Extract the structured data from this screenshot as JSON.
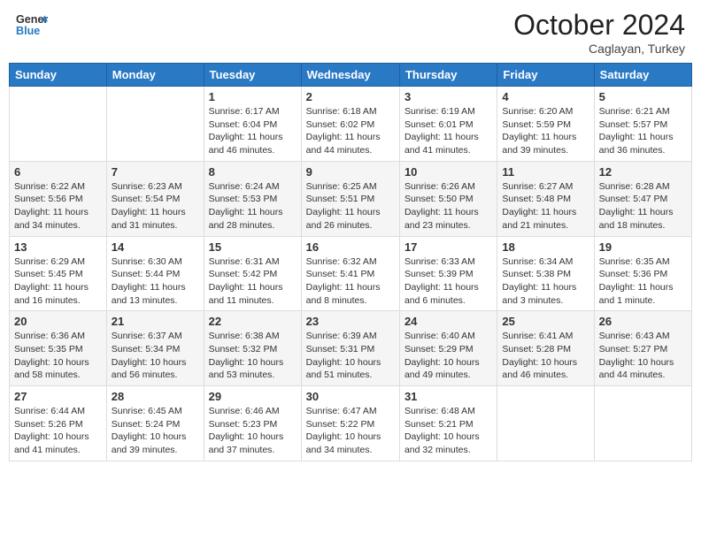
{
  "header": {
    "logo_line1": "General",
    "logo_line2": "Blue",
    "month": "October 2024",
    "location": "Caglayan, Turkey"
  },
  "weekdays": [
    "Sunday",
    "Monday",
    "Tuesday",
    "Wednesday",
    "Thursday",
    "Friday",
    "Saturday"
  ],
  "weeks": [
    [
      {
        "day": "",
        "detail": ""
      },
      {
        "day": "",
        "detail": ""
      },
      {
        "day": "1",
        "detail": "Sunrise: 6:17 AM\nSunset: 6:04 PM\nDaylight: 11 hours and 46 minutes."
      },
      {
        "day": "2",
        "detail": "Sunrise: 6:18 AM\nSunset: 6:02 PM\nDaylight: 11 hours and 44 minutes."
      },
      {
        "day": "3",
        "detail": "Sunrise: 6:19 AM\nSunset: 6:01 PM\nDaylight: 11 hours and 41 minutes."
      },
      {
        "day": "4",
        "detail": "Sunrise: 6:20 AM\nSunset: 5:59 PM\nDaylight: 11 hours and 39 minutes."
      },
      {
        "day": "5",
        "detail": "Sunrise: 6:21 AM\nSunset: 5:57 PM\nDaylight: 11 hours and 36 minutes."
      }
    ],
    [
      {
        "day": "6",
        "detail": "Sunrise: 6:22 AM\nSunset: 5:56 PM\nDaylight: 11 hours and 34 minutes."
      },
      {
        "day": "7",
        "detail": "Sunrise: 6:23 AM\nSunset: 5:54 PM\nDaylight: 11 hours and 31 minutes."
      },
      {
        "day": "8",
        "detail": "Sunrise: 6:24 AM\nSunset: 5:53 PM\nDaylight: 11 hours and 28 minutes."
      },
      {
        "day": "9",
        "detail": "Sunrise: 6:25 AM\nSunset: 5:51 PM\nDaylight: 11 hours and 26 minutes."
      },
      {
        "day": "10",
        "detail": "Sunrise: 6:26 AM\nSunset: 5:50 PM\nDaylight: 11 hours and 23 minutes."
      },
      {
        "day": "11",
        "detail": "Sunrise: 6:27 AM\nSunset: 5:48 PM\nDaylight: 11 hours and 21 minutes."
      },
      {
        "day": "12",
        "detail": "Sunrise: 6:28 AM\nSunset: 5:47 PM\nDaylight: 11 hours and 18 minutes."
      }
    ],
    [
      {
        "day": "13",
        "detail": "Sunrise: 6:29 AM\nSunset: 5:45 PM\nDaylight: 11 hours and 16 minutes."
      },
      {
        "day": "14",
        "detail": "Sunrise: 6:30 AM\nSunset: 5:44 PM\nDaylight: 11 hours and 13 minutes."
      },
      {
        "day": "15",
        "detail": "Sunrise: 6:31 AM\nSunset: 5:42 PM\nDaylight: 11 hours and 11 minutes."
      },
      {
        "day": "16",
        "detail": "Sunrise: 6:32 AM\nSunset: 5:41 PM\nDaylight: 11 hours and 8 minutes."
      },
      {
        "day": "17",
        "detail": "Sunrise: 6:33 AM\nSunset: 5:39 PM\nDaylight: 11 hours and 6 minutes."
      },
      {
        "day": "18",
        "detail": "Sunrise: 6:34 AM\nSunset: 5:38 PM\nDaylight: 11 hours and 3 minutes."
      },
      {
        "day": "19",
        "detail": "Sunrise: 6:35 AM\nSunset: 5:36 PM\nDaylight: 11 hours and 1 minute."
      }
    ],
    [
      {
        "day": "20",
        "detail": "Sunrise: 6:36 AM\nSunset: 5:35 PM\nDaylight: 10 hours and 58 minutes."
      },
      {
        "day": "21",
        "detail": "Sunrise: 6:37 AM\nSunset: 5:34 PM\nDaylight: 10 hours and 56 minutes."
      },
      {
        "day": "22",
        "detail": "Sunrise: 6:38 AM\nSunset: 5:32 PM\nDaylight: 10 hours and 53 minutes."
      },
      {
        "day": "23",
        "detail": "Sunrise: 6:39 AM\nSunset: 5:31 PM\nDaylight: 10 hours and 51 minutes."
      },
      {
        "day": "24",
        "detail": "Sunrise: 6:40 AM\nSunset: 5:29 PM\nDaylight: 10 hours and 49 minutes."
      },
      {
        "day": "25",
        "detail": "Sunrise: 6:41 AM\nSunset: 5:28 PM\nDaylight: 10 hours and 46 minutes."
      },
      {
        "day": "26",
        "detail": "Sunrise: 6:43 AM\nSunset: 5:27 PM\nDaylight: 10 hours and 44 minutes."
      }
    ],
    [
      {
        "day": "27",
        "detail": "Sunrise: 6:44 AM\nSunset: 5:26 PM\nDaylight: 10 hours and 41 minutes."
      },
      {
        "day": "28",
        "detail": "Sunrise: 6:45 AM\nSunset: 5:24 PM\nDaylight: 10 hours and 39 minutes."
      },
      {
        "day": "29",
        "detail": "Sunrise: 6:46 AM\nSunset: 5:23 PM\nDaylight: 10 hours and 37 minutes."
      },
      {
        "day": "30",
        "detail": "Sunrise: 6:47 AM\nSunset: 5:22 PM\nDaylight: 10 hours and 34 minutes."
      },
      {
        "day": "31",
        "detail": "Sunrise: 6:48 AM\nSunset: 5:21 PM\nDaylight: 10 hours and 32 minutes."
      },
      {
        "day": "",
        "detail": ""
      },
      {
        "day": "",
        "detail": ""
      }
    ]
  ]
}
